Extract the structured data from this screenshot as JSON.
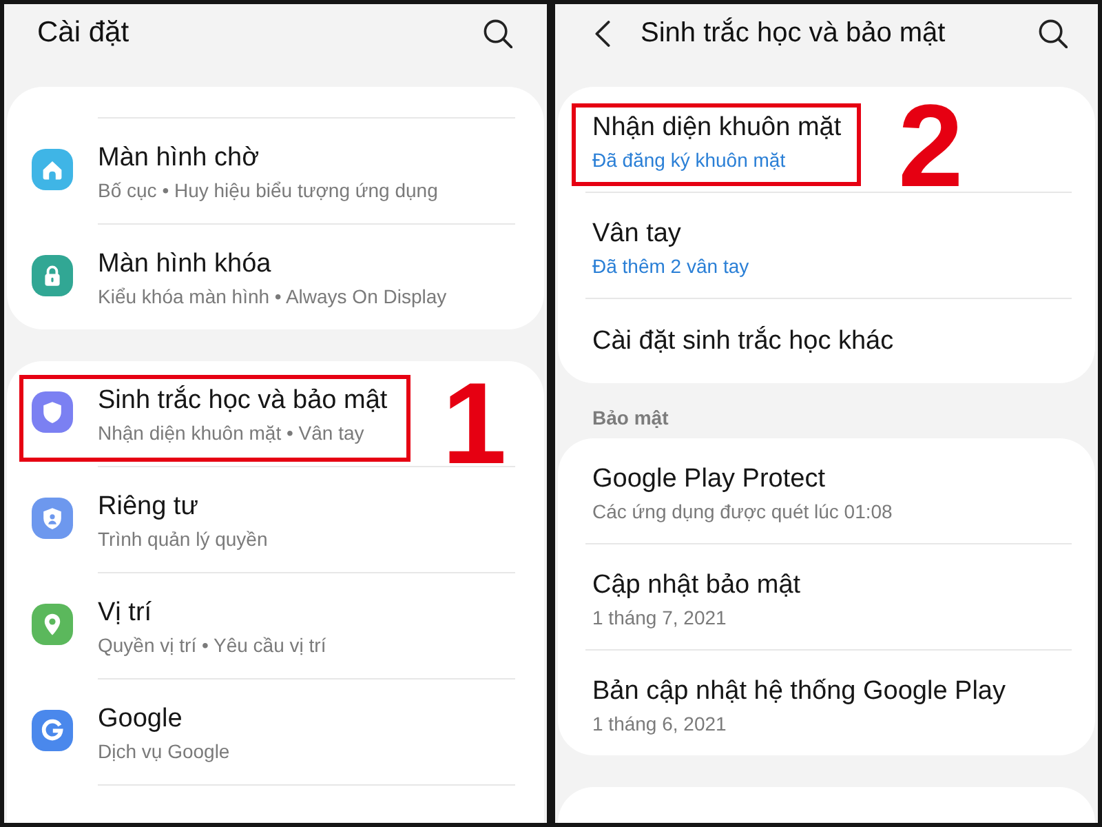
{
  "left_screen": {
    "title": "Cài đặt",
    "cards": [
      {
        "cut_top": true,
        "cut_bottom": false,
        "items": [
          {
            "title": "Màn hình chờ",
            "subtitle": "Bố cục • Huy hiệu biểu tượng ứng dụng",
            "color": "#3fb5e6",
            "highlighted": false
          },
          {
            "title": "Màn hình khóa",
            "subtitle": "Kiểu khóa màn hình • Always On Display",
            "color": "#31a794",
            "highlighted": false
          }
        ]
      },
      {
        "cut_top": false,
        "cut_bottom": true,
        "items": [
          {
            "title": "Sinh trắc học và bảo mật",
            "subtitle": "Nhận diện khuôn mặt • Vân tay",
            "color": "#7b80f2",
            "highlighted": true,
            "callout": "1"
          },
          {
            "title": "Riêng tư",
            "subtitle": "Trình quản lý quyền",
            "color": "#6d98ee",
            "highlighted": false
          },
          {
            "title": "Vị trí",
            "subtitle": "Quyền vị trí • Yêu cầu vị trí",
            "color": "#5bb85c",
            "highlighted": false
          },
          {
            "title": "Google",
            "subtitle": "Dịch vụ Google",
            "color": "#4a88ec",
            "highlighted": false
          }
        ]
      }
    ]
  },
  "right_screen": {
    "title": "Sinh trắc học và bảo mật",
    "cards": [
      {
        "cut_bottom": false,
        "items": [
          {
            "title": "Nhận diện khuôn mặt",
            "subtitle": "Đã đăng ký khuôn mặt",
            "accent": true,
            "highlighted": true,
            "callout": "2"
          },
          {
            "title": "Vân tay",
            "subtitle": "Đã thêm 2 vân tay",
            "accent": true,
            "highlighted": false
          },
          {
            "title": "Cài đặt sinh trắc học khác",
            "highlighted": false
          }
        ]
      },
      {
        "header": "Bảo mật",
        "cut_bottom": false,
        "items": [
          {
            "title": "Google Play Protect",
            "subtitle": "Các ứng dụng được quét lúc 01:08",
            "accent": false,
            "highlighted": false
          },
          {
            "title": "Cập nhật bảo mật",
            "subtitle": "1 tháng 7, 2021",
            "accent": false,
            "highlighted": false
          },
          {
            "title": "Bản cập nhật hệ thống Google Play",
            "subtitle": "1 tháng 6, 2021",
            "accent": false,
            "highlighted": false
          }
        ]
      },
      {
        "cut_bottom": true
      }
    ]
  }
}
